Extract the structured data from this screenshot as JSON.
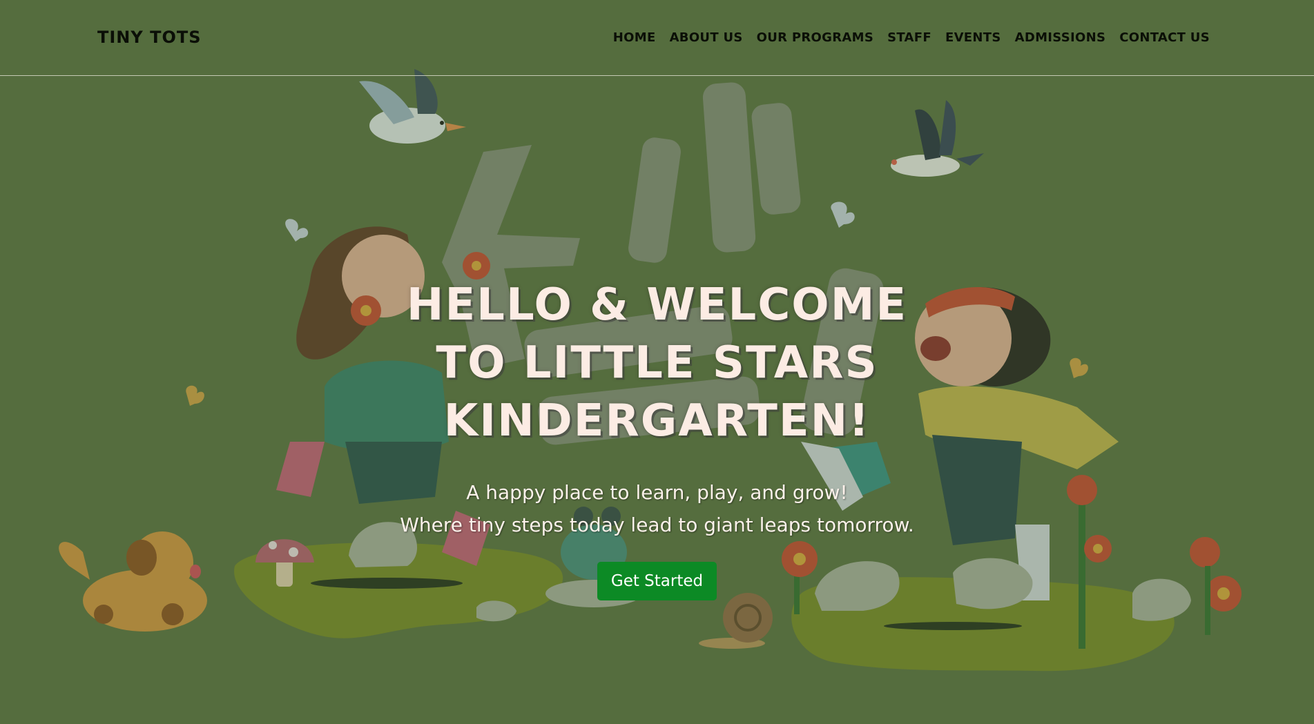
{
  "brand": "TINY TOTS",
  "nav": {
    "items": [
      {
        "label": "HOME"
      },
      {
        "label": "ABOUT US"
      },
      {
        "label": "OUR PROGRAMS"
      },
      {
        "label": "STAFF"
      },
      {
        "label": "EVENTS"
      },
      {
        "label": "ADMISSIONS"
      },
      {
        "label": "CONTACT US"
      }
    ]
  },
  "hero": {
    "title": "HELLO & WELCOME TO LITTLE STARS KINDERGARTEN!",
    "subtitle_line1": "A happy place to learn, play, and grow!",
    "subtitle_line2": "Where tiny steps today lead to giant leaps tomorrow.",
    "cta_label": "Get Started"
  },
  "colors": {
    "background": "#556d3e",
    "heading": "#fcece4",
    "cta": "#0c8a25",
    "nav_text": "#0b0f07"
  }
}
